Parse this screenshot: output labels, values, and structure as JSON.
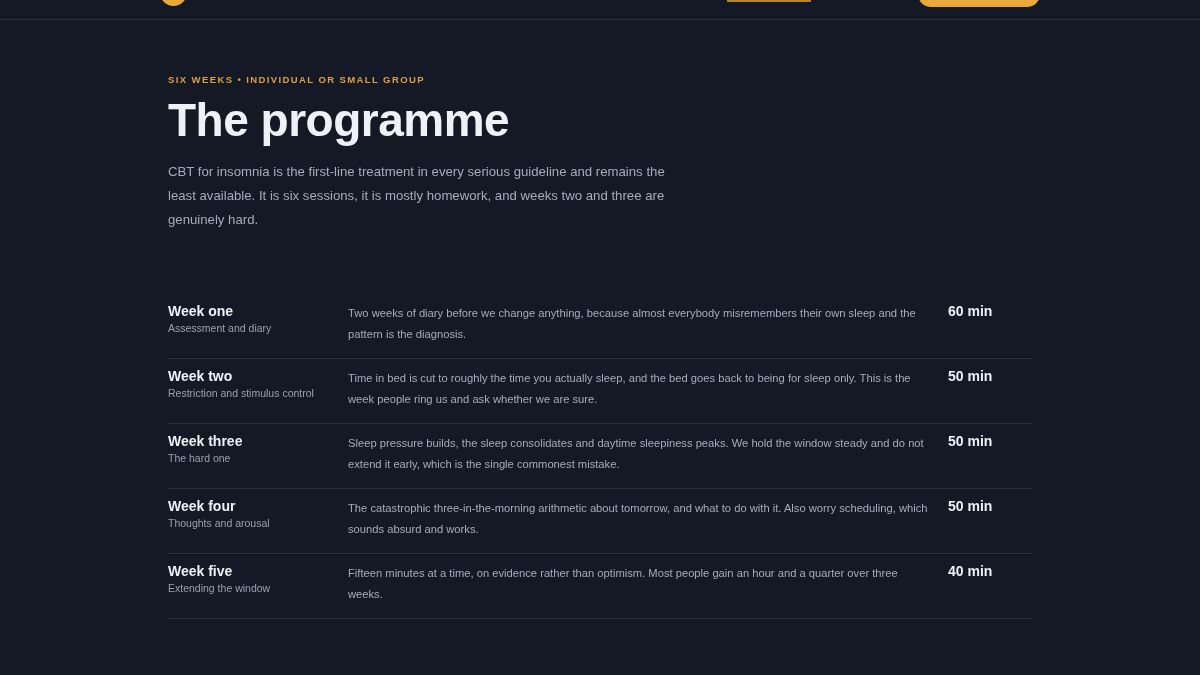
{
  "section": {
    "eyebrow": "SIX WEEKS • INDIVIDUAL OR SMALL GROUP",
    "title": "The programme",
    "intro": "CBT for insomnia is the first-line treatment in every serious guideline and remains the least available. It is six sessions, it is mostly homework, and weeks two and three are genuinely hard."
  },
  "weeks": [
    {
      "title": "Week one",
      "subtitle": "Assessment and diary",
      "description": "Two weeks of diary before we change anything, because almost everybody misremembers their own sleep and the pattern is the diagnosis.",
      "duration": "60 min"
    },
    {
      "title": "Week two",
      "subtitle": "Restriction and stimulus control",
      "description": "Time in bed is cut to roughly the time you actually sleep, and the bed goes back to being for sleep only. This is the week people ring us and ask whether we are sure.",
      "duration": "50 min"
    },
    {
      "title": "Week three",
      "subtitle": "The hard one",
      "description": "Sleep pressure builds, the sleep consolidates and daytime sleepiness peaks. We hold the window steady and do not extend it early, which is the single commonest mistake.",
      "duration": "50 min"
    },
    {
      "title": "Week four",
      "subtitle": "Thoughts and arousal",
      "description": "The catastrophic three-in-the-morning arithmetic about tomorrow, and what to do with it. Also worry scheduling, which sounds absurd and works.",
      "duration": "50 min"
    },
    {
      "title": "Week five",
      "subtitle": "Extending the window",
      "description": "Fifteen minutes at a time, on evidence rather than optimism. Most people gain an hour and a quarter over three weeks.",
      "duration": "40 min"
    }
  ]
}
